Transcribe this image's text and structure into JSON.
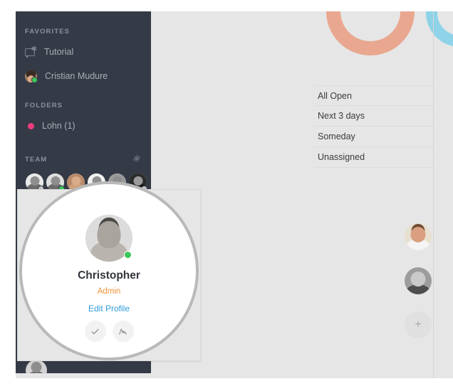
{
  "sidebar": {
    "sections": {
      "favorites_title": "FAVORITES",
      "folders_title": "FOLDERS",
      "team_title": "TEAM"
    },
    "favorites": [
      {
        "label": "Tutorial",
        "icon": "chat-star-icon"
      },
      {
        "label": "Cristian Mudure",
        "icon": "avatar",
        "status": "online"
      }
    ],
    "folders": [
      {
        "label": "Lohn (1)",
        "dot_color": "#ef3d7e"
      }
    ],
    "team_settings_icon": "gear-icon",
    "team_members": [
      {
        "status": "offline"
      },
      {
        "status": "online"
      },
      {
        "status": "online"
      },
      {
        "status": "offline"
      },
      {
        "status": "online"
      },
      {
        "status": "offline"
      }
    ]
  },
  "filters": {
    "items": [
      {
        "label": "All Open"
      },
      {
        "label": "Next 3 days"
      },
      {
        "label": "Someday"
      },
      {
        "label": "Unassigned"
      }
    ]
  },
  "right_rail": {
    "add_button_label": "+",
    "avatars": [
      {
        "name": "rail-avatar-1"
      },
      {
        "name": "rail-avatar-2"
      }
    ]
  },
  "profile_popup": {
    "name": "Christopher",
    "role": "Admin",
    "edit_profile_label": "Edit Profile",
    "status": "online",
    "actions": [
      {
        "icon": "check-icon",
        "glyph": "✓"
      },
      {
        "icon": "pulse-icon",
        "glyph": "ᴧ"
      }
    ]
  },
  "decor": {
    "ring_salmon_color": "#e9a78f",
    "ring_blue_color": "#8fd3e8"
  },
  "theme": {
    "sidebar_bg": "#343a46",
    "content_bg": "#e6e6e6",
    "accent_orange": "#f0923a",
    "accent_blue": "#2d9cdb",
    "accent_pink": "#ef3d7e",
    "online_green": "#3ec65a"
  }
}
